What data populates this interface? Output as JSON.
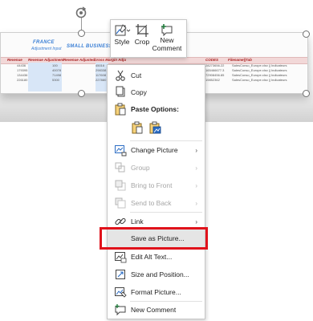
{
  "picture": {
    "title": "FRANCE",
    "subtitle": "Adjustment Input",
    "section": "SMALL BUSINESS",
    "headers": [
      "Revenue",
      "Revenue Adjustment",
      "Revenue Adjusted",
      "Gross Margin Adju",
      "CODES",
      "Filename||Tab"
    ],
    "row_fragments": [
      "44436",
      "179395",
      "134436",
      "226180",
      "100",
      "40078",
      "71498",
      "5300",
      "45016",
      "298338",
      "117608",
      "227880",
      "28273656.22",
      "165466677.3",
      "72908456.85",
      "19852362",
      "SalesConso_Europe.xlsx || Indicateurs",
      "SalesConso_Europe.xlsx || Indicateurs",
      "SalesConso_Europe.xlsx || Indicateurs",
      "SalesConso_Europe.xlsx || Indicateurs"
    ]
  },
  "mini_toolbar": {
    "style_label": "Style",
    "crop_label": "Crop",
    "new_comment_label_1": "New",
    "new_comment_label_2": "Comment"
  },
  "menu": {
    "items": [
      {
        "label": "Cut",
        "icon": "scissors-icon",
        "enabled": true
      },
      {
        "label": "Copy",
        "icon": "copy-icon",
        "enabled": true
      },
      {
        "label": "Paste Options:",
        "icon": "paste-icon",
        "enabled": true
      },
      {
        "label": "Change Picture",
        "icon": "change-picture-icon",
        "enabled": true,
        "submenu": true
      },
      {
        "label": "Group",
        "icon": "group-icon",
        "enabled": false,
        "submenu": true
      },
      {
        "label": "Bring to Front",
        "icon": "bring-to-front-icon",
        "enabled": false,
        "submenu": true
      },
      {
        "label": "Send to Back",
        "icon": "send-to-back-icon",
        "enabled": false,
        "submenu": true
      },
      {
        "label": "Link",
        "icon": "link-icon",
        "enabled": true,
        "submenu": true
      },
      {
        "label": "Save as Picture...",
        "icon": "",
        "enabled": true,
        "highlighted": true
      },
      {
        "label": "Edit Alt Text...",
        "icon": "alt-text-icon",
        "enabled": true
      },
      {
        "label": "Size and Position...",
        "icon": "size-position-icon",
        "enabled": true
      },
      {
        "label": "Format Picture...",
        "icon": "format-picture-icon",
        "enabled": true
      },
      {
        "label": "New Comment",
        "icon": "comment-icon",
        "enabled": true
      }
    ],
    "arrow_glyph": "›"
  },
  "colors": {
    "highlight_border": "#e0121b",
    "accent_blue": "#2b6cc4",
    "disabled_text": "#a6a6a6"
  }
}
